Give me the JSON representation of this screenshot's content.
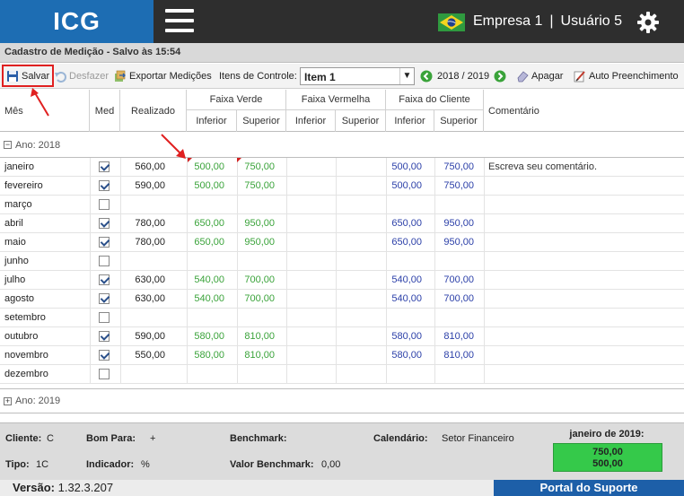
{
  "app": {
    "logo": "ICG",
    "company": "Empresa 1",
    "separator": "|",
    "user": "Usuário 5"
  },
  "window": {
    "title": "Cadastro de Medição - Salvo às 15:54"
  },
  "toolbar": {
    "save_label": "Salvar",
    "undo_label": "Desfazer",
    "export_label": "Exportar Medições",
    "control_items_label": "Itens de Controle:",
    "control_item_value": "Item 1",
    "period": "2018 / 2019",
    "clear_label": "Apagar",
    "autofill_label": "Auto Preenchimento"
  },
  "grid": {
    "headers": {
      "mes": "Mês",
      "med": "Med",
      "realizado": "Realizado",
      "faixa_verde": "Faixa Verde",
      "faixa_vermelha": "Faixa Vermelha",
      "faixa_cliente": "Faixa do Cliente",
      "inferior": "Inferior",
      "superior": "Superior",
      "comentario": "Comentário"
    },
    "group_2018": "Ano: 2018",
    "group_2019": "Ano: 2019",
    "rows": [
      {
        "mes": "janeiro",
        "med": true,
        "realizado": "560,00",
        "verde_inf": "500,00",
        "verde_sup": "750,00",
        "cli_inf": "500,00",
        "cli_sup": "750,00",
        "comentario": "Escreva seu comentário."
      },
      {
        "mes": "fevereiro",
        "med": true,
        "realizado": "590,00",
        "verde_inf": "500,00",
        "verde_sup": "750,00",
        "cli_inf": "500,00",
        "cli_sup": "750,00",
        "comentario": ""
      },
      {
        "mes": "março",
        "med": false,
        "realizado": "",
        "verde_inf": "",
        "verde_sup": "",
        "cli_inf": "",
        "cli_sup": "",
        "comentario": ""
      },
      {
        "mes": "abril",
        "med": true,
        "realizado": "780,00",
        "verde_inf": "650,00",
        "verde_sup": "950,00",
        "cli_inf": "650,00",
        "cli_sup": "950,00",
        "comentario": ""
      },
      {
        "mes": "maio",
        "med": true,
        "realizado": "780,00",
        "verde_inf": "650,00",
        "verde_sup": "950,00",
        "cli_inf": "650,00",
        "cli_sup": "950,00",
        "comentario": ""
      },
      {
        "mes": "junho",
        "med": false,
        "realizado": "",
        "verde_inf": "",
        "verde_sup": "",
        "cli_inf": "",
        "cli_sup": "",
        "comentario": ""
      },
      {
        "mes": "julho",
        "med": true,
        "realizado": "630,00",
        "verde_inf": "540,00",
        "verde_sup": "700,00",
        "cli_inf": "540,00",
        "cli_sup": "700,00",
        "comentario": ""
      },
      {
        "mes": "agosto",
        "med": true,
        "realizado": "630,00",
        "verde_inf": "540,00",
        "verde_sup": "700,00",
        "cli_inf": "540,00",
        "cli_sup": "700,00",
        "comentario": ""
      },
      {
        "mes": "setembro",
        "med": false,
        "realizado": "",
        "verde_inf": "",
        "verde_sup": "",
        "cli_inf": "",
        "cli_sup": "",
        "comentario": ""
      },
      {
        "mes": "outubro",
        "med": true,
        "realizado": "590,00",
        "verde_inf": "580,00",
        "verde_sup": "810,00",
        "cli_inf": "580,00",
        "cli_sup": "810,00",
        "comentario": ""
      },
      {
        "mes": "novembro",
        "med": true,
        "realizado": "550,00",
        "verde_inf": "580,00",
        "verde_sup": "810,00",
        "cli_inf": "580,00",
        "cli_sup": "810,00",
        "comentario": ""
      },
      {
        "mes": "dezembro",
        "med": false,
        "realizado": "",
        "verde_inf": "",
        "verde_sup": "",
        "cli_inf": "",
        "cli_sup": "",
        "comentario": ""
      }
    ]
  },
  "footer": {
    "cliente_label": "Cliente:",
    "cliente_value": "C",
    "tipo_label": "Tipo:",
    "tipo_value": "1C",
    "bom_para_label": "Bom Para:",
    "bom_para_value": "+",
    "indicador_label": "Indicador:",
    "indicador_value": "%",
    "benchmark_label": "Benchmark:",
    "benchmark_value": "",
    "valor_benchmark_label": "Valor Benchmark:",
    "valor_benchmark_value": "0,00",
    "calendario_label": "Calendário:",
    "calendario_value": "Setor Financeiro",
    "summary_title": "janeiro de 2019:",
    "summary_line1": "750,00",
    "summary_line2": "500,00"
  },
  "status": {
    "versao_label": "Versão:",
    "versao_value": "1.32.3.207",
    "portal": "Portal do Suporte"
  },
  "colors": {
    "brand": "#1d6db3",
    "green_band": "#3aa33a",
    "client_band": "#2b3fa8",
    "summary_ok": "#35c94a",
    "highlight": "#e02020"
  },
  "icons": [
    "menu-icon",
    "brazil-flag-icon",
    "gear-icon",
    "save-icon",
    "undo-icon",
    "export-icon",
    "prev-icon",
    "next-icon",
    "eraser-icon",
    "autofill-icon"
  ]
}
